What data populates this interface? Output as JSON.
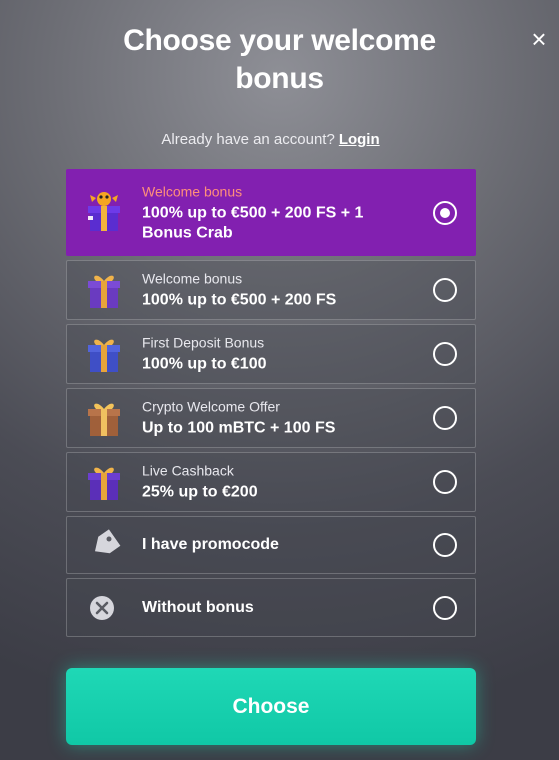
{
  "header": {
    "title_line1": "Choose your welcome",
    "title_line2": "bonus",
    "close_symbol": "×"
  },
  "account": {
    "prompt": "Already have an account?",
    "login_label": "Login"
  },
  "options": [
    {
      "small": "Welcome bonus",
      "big_line1": "100% up to €500 + 200 FS + 1",
      "big_line2": "Bonus Crab",
      "icon": "gift-crab-icon",
      "selected": true
    },
    {
      "small": "Welcome bonus",
      "big": "100% up to €500 + 200 FS",
      "icon": "gift-purple-icon",
      "selected": false
    },
    {
      "small": "First Deposit Bonus",
      "big": "100% up to €100",
      "icon": "gift-blue-icon",
      "selected": false
    },
    {
      "small": "Crypto Welcome Offer",
      "big": "Up to 100 mBTC + 100 FS",
      "icon": "gift-brown-icon",
      "selected": false
    },
    {
      "small": "Live Cashback",
      "big": "25% up to €200",
      "icon": "gift-violet-icon",
      "selected": false
    },
    {
      "big": "I have promocode",
      "icon": "tag-icon",
      "selected": false
    },
    {
      "big": "Without bonus",
      "icon": "cancel-icon",
      "selected": false
    }
  ],
  "cta": {
    "label": "Choose"
  },
  "colors": {
    "selected_bg": "#8220b0",
    "selected_subtitle": "#ff8f7a",
    "cta": "#10c8a6"
  }
}
